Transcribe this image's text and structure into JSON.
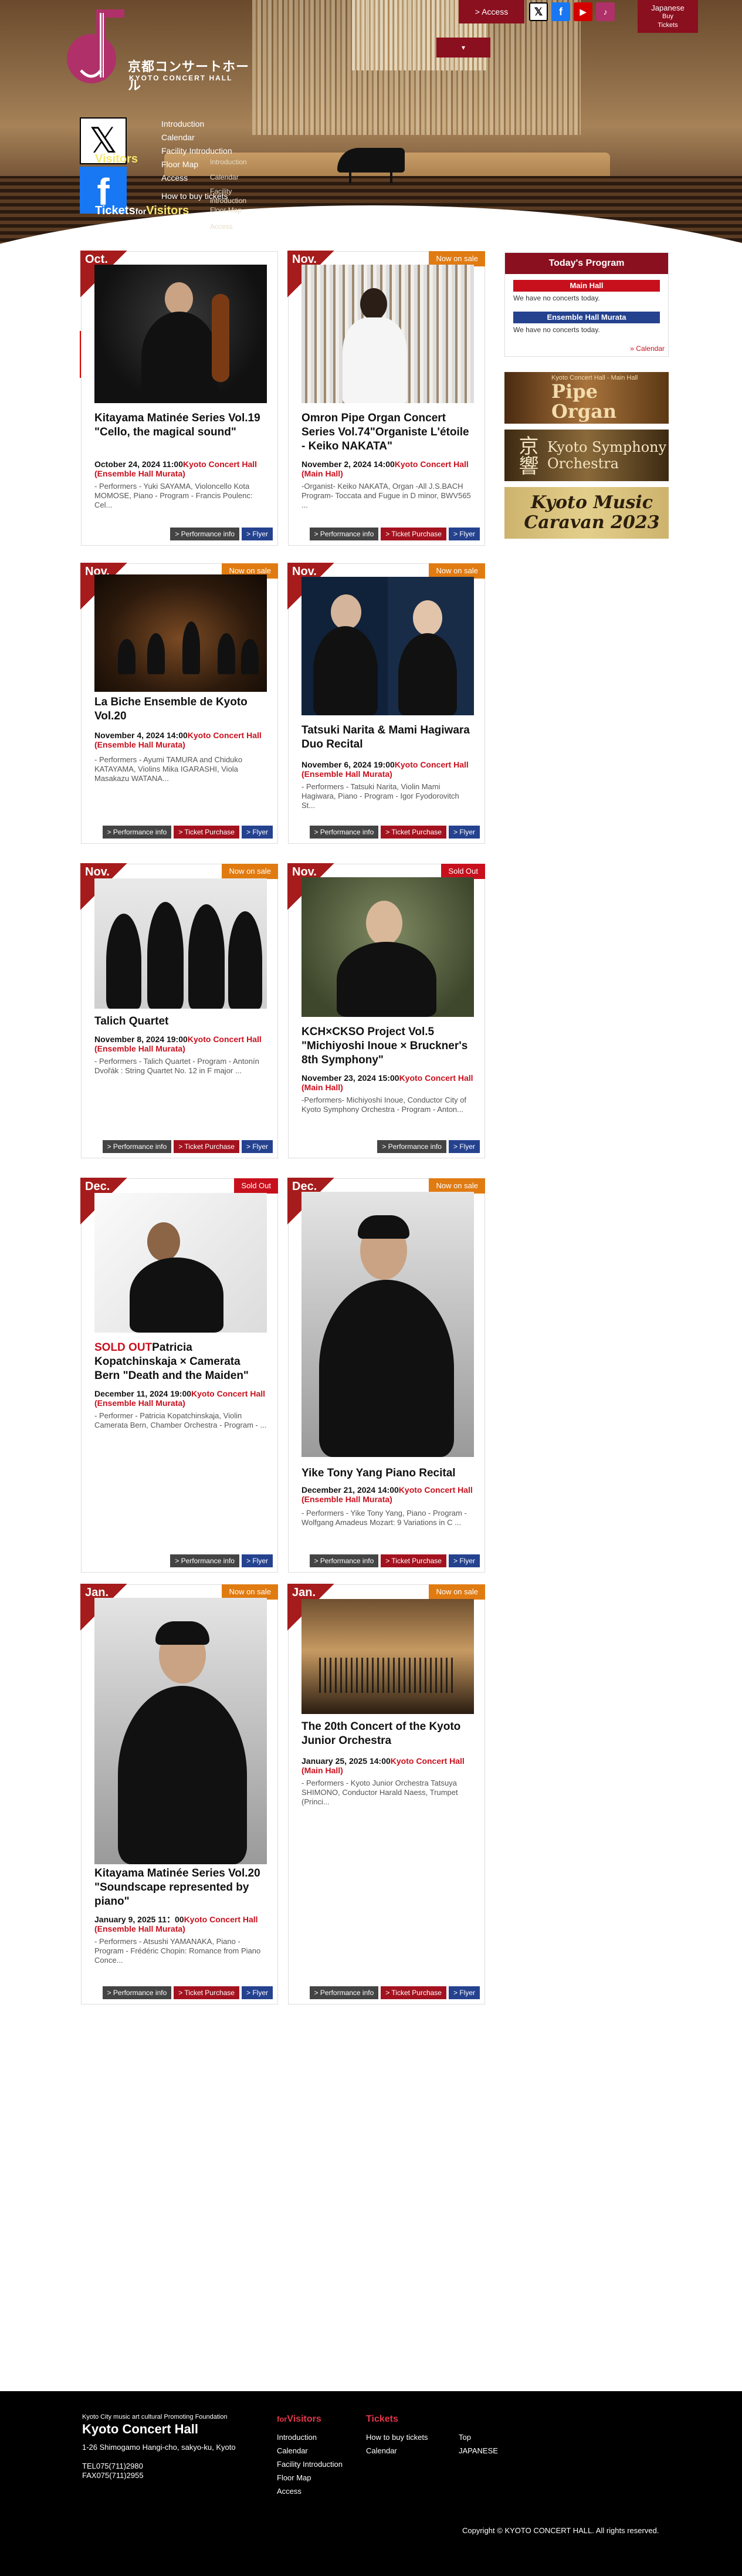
{
  "header": {
    "logo_ja": "京都コンサートホール",
    "logo_en": "KYOTO CONCERT HALL",
    "access": "> Access",
    "lang_main": "Japanese",
    "lang_sub1": "Buy",
    "lang_sub2": "Tickets",
    "visitors_prefix": "for",
    "visitors_word": "Visitors",
    "tickets_word": "Tickets",
    "tickets_for": "for",
    "tickets_visitors": "Visitors",
    "menu_main": [
      "Introduction",
      "Calendar",
      "Facility Introduction",
      "Floor Map",
      "Access",
      "How to buy tickets"
    ],
    "menu_sub": [
      "Introduction",
      "Calendar",
      "Facility",
      "introduction",
      "Floor Map",
      "Access"
    ]
  },
  "cards": [
    {
      "month": "Oct.",
      "badge": "",
      "title": "Kitayama Matinée Series Vol.19 \"Cello, the magical sound\"",
      "date": "October 24, 2024 11:00",
      "hall": "Kyoto Concert Hall (Ensemble Hall Murata)",
      "desc": "- Performers - Yuki SAYAMA, Violoncello Kota MOMOSE, Piano - Program - Francis Poulenc: Cel...",
      "btn_info": "> Performance info",
      "btn_ticket": "",
      "btn_flyer": "> Flyer"
    },
    {
      "month": "Nov.",
      "badge": "Now on sale",
      "title": "Omron Pipe Organ Concert Series Vol.74\"Organiste L'étoile - Keiko NAKATA\"",
      "date": "November 2, 2024 14:00",
      "hall": "Kyoto Concert Hall (Main Hall)",
      "desc": "-Organist- Keiko NAKATA, Organ -All J.S.BACH Program- Toccata and Fugue in D minor, BWV565 ...",
      "btn_info": "> Performance info",
      "btn_ticket": "> Ticket Purchase",
      "btn_flyer": "> Flyer"
    },
    {
      "month": "Nov.",
      "badge": "Now on sale",
      "title": "La Biche Ensemble de Kyoto Vol.20",
      "date": "November 4, 2024 14:00",
      "hall": "Kyoto Concert Hall (Ensemble Hall Murata)",
      "desc": "- Performers - Ayumi TAMURA and Chiduko KATAYAMA, Violins Mika IGARASHI, Viola Masakazu WATANA...",
      "btn_info": "> Performance info",
      "btn_ticket": "> Ticket Purchase",
      "btn_flyer": "> Flyer"
    },
    {
      "month": "Nov.",
      "badge": "Now on sale",
      "title": "Tatsuki Narita & Mami Hagiwara Duo Recital",
      "date": "November 6, 2024 19:00",
      "hall": "Kyoto Concert Hall (Ensemble Hall Murata)",
      "desc": "- Performers - Tatsuki Narita, Violin Mami Hagiwara, Piano - Program - Igor Fyodorovitch St...",
      "btn_info": "> Performance info",
      "btn_ticket": "> Ticket Purchase",
      "btn_flyer": "> Flyer"
    },
    {
      "month": "Nov.",
      "badge": "Now on sale",
      "title": "Talich Quartet",
      "date": "November 8, 2024 19:00",
      "hall": "Kyoto Concert Hall (Ensemble Hall Murata)",
      "desc": "- Performers - Talich Quartet - Program - Antonín Dvořák : String Quartet No. 12 in F major ...",
      "btn_info": "> Performance info",
      "btn_ticket": "> Ticket Purchase",
      "btn_flyer": "> Flyer"
    },
    {
      "month": "Nov.",
      "badge": "Sold Out",
      "title": "KCH×CKSO Project Vol.5 \"Michiyoshi Inoue × Bruckner's 8th Symphony\"",
      "date": "November 23, 2024 15:00",
      "hall": "Kyoto Concert Hall (Main Hall)",
      "desc": "-Performers- Michiyoshi Inoue, Conductor City of Kyoto Symphony Orchestra - Program - Anton...",
      "btn_info": "> Performance info",
      "btn_ticket": "",
      "btn_flyer": "> Flyer"
    },
    {
      "month": "Dec.",
      "badge": "Sold Out",
      "soldout_prefix": "SOLD OUT",
      "title": "Patricia Kopatchinskaja × Camerata Bern \"Death and the Maiden\"",
      "date": "December 11, 2024 19:00",
      "hall": "Kyoto Concert Hall (Ensemble Hall Murata)",
      "desc": "- Performer - Patricia Kopatchinskaja, Violin Camerata Bern, Chamber Orchestra - Program - ...",
      "btn_info": "> Performance info",
      "btn_ticket": "",
      "btn_flyer": "> Flyer"
    },
    {
      "month": "Dec.",
      "badge": "Now on sale",
      "title": "Yike Tony Yang Piano Recital",
      "date": "December 21, 2024 14:00",
      "hall": "Kyoto Concert Hall (Ensemble Hall Murata)",
      "desc": "- Performers - Yike Tony Yang, Piano - Program - Wolfgang Amadeus Mozart: 9 Variations in C ...",
      "btn_info": "> Performance info",
      "btn_ticket": "> Ticket Purchase",
      "btn_flyer": "> Flyer"
    },
    {
      "month": "Jan.",
      "badge": "Now on sale",
      "title": "Kitayama Matinée Series Vol.20 \"Soundscape represented by piano\"",
      "date": "January 9, 2025 11：00",
      "hall": "Kyoto Concert Hall (Ensemble Hall Murata)",
      "desc": "- Performers - Atsushi YAMANAKA, Piano - Program - Frédéric Chopin: Romance from Piano Conce...",
      "btn_info": "> Performance info",
      "btn_ticket": "> Ticket Purchase",
      "btn_flyer": "> Flyer"
    },
    {
      "month": "Jan.",
      "badge": "Now on sale",
      "title": "The 20th Concert of the Kyoto Junior Orchestra",
      "date": "January 25, 2025 14:00",
      "hall": "Kyoto Concert Hall (Main Hall)",
      "desc": "- Performers - Kyoto Junior Orchestra Tatsuya SHIMONO, Conductor Harald Naess, Trumpet (Princi...",
      "btn_info": "> Performance info",
      "btn_ticket": "> Ticket Purchase",
      "btn_flyer": "> Flyer"
    }
  ],
  "sidebar": {
    "title": "Today's Program",
    "main_hall": "Main Hall",
    "main_none": "We have no concerts today.",
    "ens_hall": "Ensemble Hall Murata",
    "ens_none": "We have no concerts today.",
    "calendar": "» Calendar",
    "banner1_small": "Kyoto Concert Hall - Main Hall",
    "banner1_big": "Pipe Organ",
    "banner2_small": "京響",
    "banner2_big": "Kyoto Symphony Orchestra",
    "banner3_big": "Kyoto Music Caravan 2023"
  },
  "footer": {
    "tagline": "Kyoto City music art cultural Promoting Foundation",
    "name": "Kyoto Concert Hall",
    "address": "1-26 Shimogamo Hangi-cho, sakyo-ku, Kyoto",
    "tel": "TEL075(711)2980",
    "fax": "FAX075(711)2955",
    "col1_title_prefix": "for",
    "col1_title": "Visitors",
    "col1_items": [
      "Introduction",
      "Calendar",
      "Facility Introduction",
      "Floor Map",
      "Access"
    ],
    "col2_title": "Tickets",
    "col2_items": [
      "How to buy tickets",
      "Calendar"
    ],
    "col3_items": [
      "Top",
      "JAPANESE"
    ],
    "copyright": "Copyright © KYOTO CONCERT HALL. All rights reserved."
  },
  "colors": {
    "brand": "#8a0f1f",
    "hall": "#c8101d",
    "flyer": "#25428f",
    "onsale": "#e07b12"
  }
}
